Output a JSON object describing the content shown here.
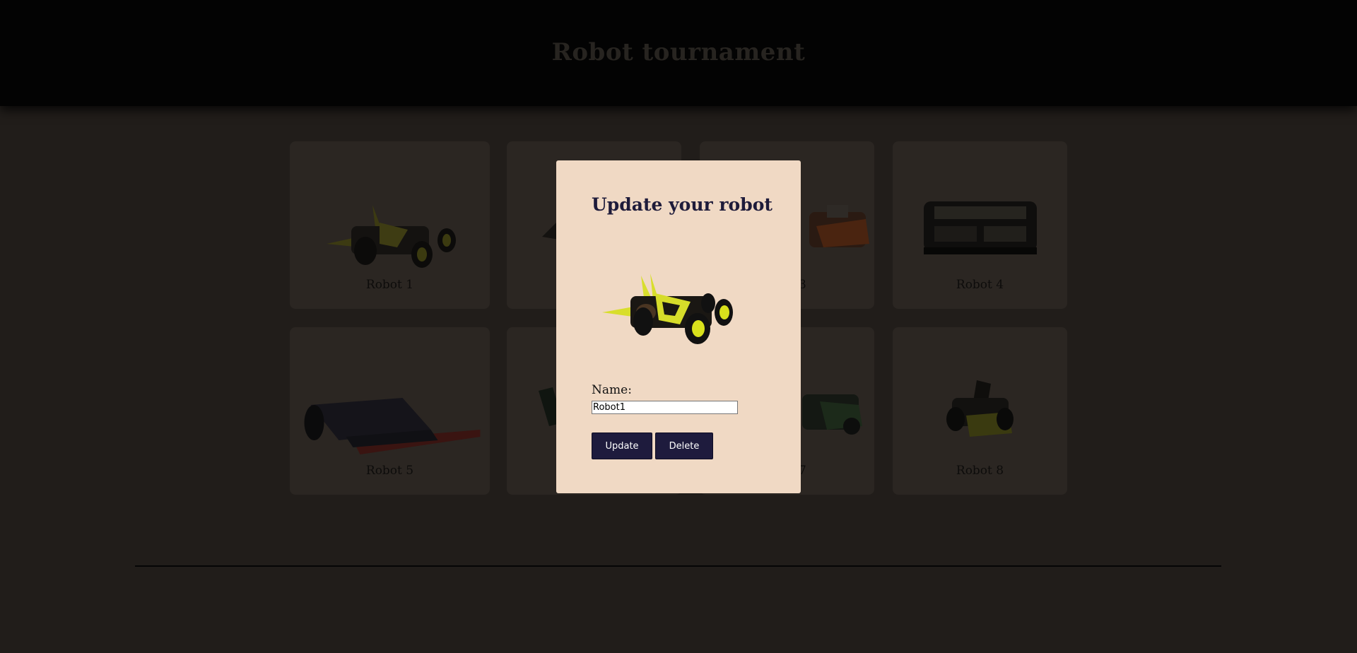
{
  "header": {
    "title": "Robot tournament"
  },
  "cards": [
    {
      "label": "Robot 1",
      "art": "robot-1-image"
    },
    {
      "label": "",
      "art": "robot-2-image"
    },
    {
      "label": "3",
      "art": "robot-3-image"
    },
    {
      "label": "Robot 4",
      "art": "robot-4-image"
    },
    {
      "label": "Robot 5",
      "art": "robot-5-image"
    },
    {
      "label": "",
      "art": "robot-6-image"
    },
    {
      "label": "7",
      "art": "robot-7-image"
    },
    {
      "label": "Robot 8",
      "art": "robot-8-image"
    }
  ],
  "modal": {
    "title": "Update your robot",
    "name_label": "Name:",
    "name_value": "Robot1",
    "update_label": "Update",
    "delete_label": "Delete",
    "preview_art": "robot-1-image"
  },
  "colors": {
    "background": "#211d1a",
    "header_bg": "#030303",
    "modal_bg": "#f0d9c4",
    "button_bg": "#1e1b3d",
    "title_color": "#1e1b3a"
  }
}
